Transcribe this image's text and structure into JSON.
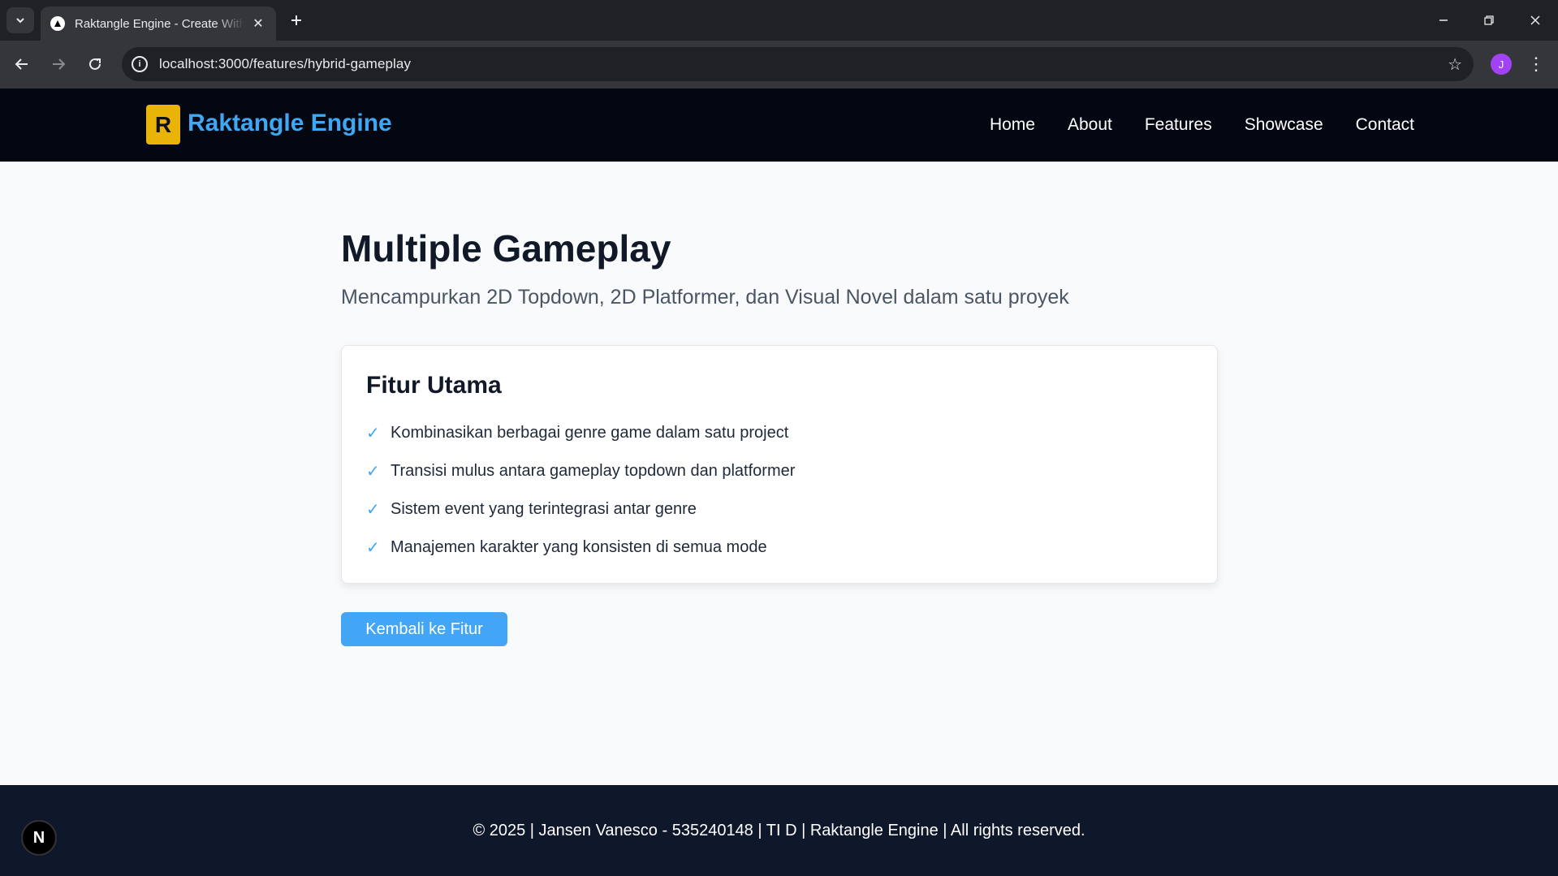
{
  "browser": {
    "tab_title": "Raktangle Engine - Create With Ease",
    "url": "localhost:3000/features/hybrid-gameplay",
    "profile_initial": "J"
  },
  "header": {
    "logo_letter": "R",
    "brand": "Raktangle Engine",
    "nav": [
      "Home",
      "About",
      "Features",
      "Showcase",
      "Contact"
    ]
  },
  "main": {
    "title": "Multiple Gameplay",
    "subtitle": "Mencampurkan 2D Topdown, 2D Platformer, dan Visual Novel dalam satu proyek",
    "card_title": "Fitur Utama",
    "features": [
      "Kombinasikan berbagai genre game dalam satu project",
      "Transisi mulus antara gameplay topdown dan platformer",
      "Sistem event yang terintegrasi antar genre",
      "Manajemen karakter yang konsisten di semua mode"
    ],
    "back_button": "Kembali ke Fitur"
  },
  "footer": {
    "text": "© 2025 | Jansen Vanesco - 535240148 | TI D | Raktangle Engine | All rights reserved."
  },
  "badge": {
    "letter": "N"
  },
  "colors": {
    "accent": "#3ea8f4",
    "logo": "#eab308",
    "header_bg": "#030712",
    "footer_bg": "#0f172a"
  },
  "icons": {
    "check": "check-icon"
  }
}
